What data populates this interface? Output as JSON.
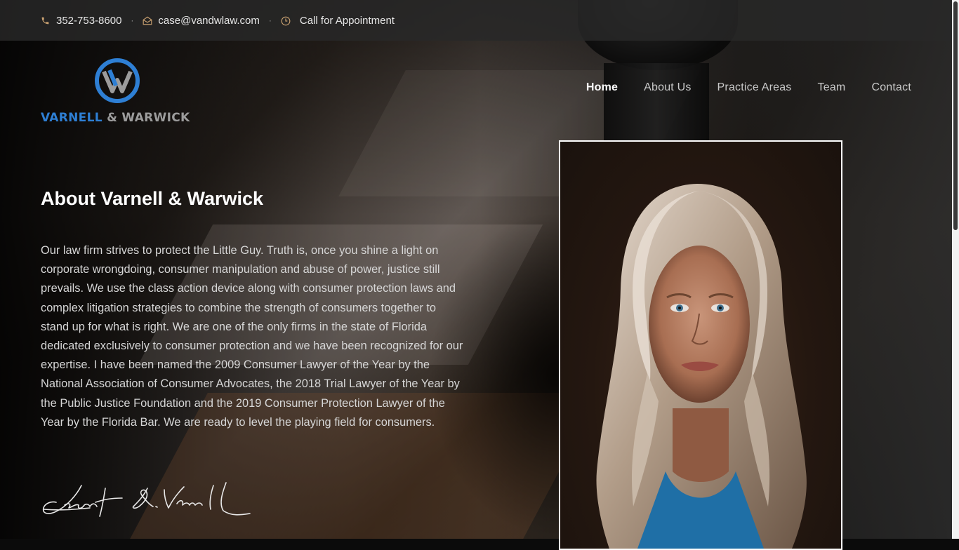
{
  "topbar": {
    "phone": "352-753-8600",
    "email": "case@vandwlaw.com",
    "hours": "Call for Appointment",
    "separator": "·",
    "icons": [
      "phone-icon",
      "envelope-icon",
      "clock-icon"
    ],
    "icon_color": "#c8a070"
  },
  "logo": {
    "name_part1": "VARNELL",
    "name_amp": " & ",
    "name_part2": "WARWICK",
    "brand_blue": "#2e7fd4",
    "brand_grey": "#9c9c9c"
  },
  "nav": {
    "items": [
      {
        "label": "Home",
        "active": true
      },
      {
        "label": "About Us",
        "active": false
      },
      {
        "label": "Practice Areas",
        "active": false
      },
      {
        "label": "Team",
        "active": false
      },
      {
        "label": "Contact",
        "active": false
      }
    ]
  },
  "main": {
    "heading": "About Varnell & Warwick",
    "body": "Our law firm strives to protect the Little Guy. Truth is, once you shine a light on corporate wrongdoing, consumer manipulation and abuse of power, justice still prevails. We use the class action device along with consumer protection laws and complex litigation strategies to combine the strength of consumers together to stand up for what is right. We are one of the only firms in the state of Florida dedicated exclusively to consumer protection and we have been recognized for our expertise. I have been named the 2009 Consumer Lawyer of the Year by the National Association of Consumer Advocates, the 2018 Trial Lawyer of the Year by the Public Justice Foundation and the 2019 Consumer Protection Lawyer of the Year by the Florida Bar. We are ready to level the playing field for consumers.",
    "signature": "Janet R. Varnell"
  }
}
